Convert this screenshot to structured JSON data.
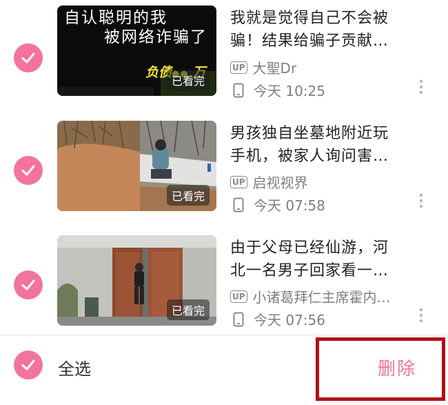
{
  "colors": {
    "accent": "#f3739f",
    "highlight_border": "#b10f17"
  },
  "videos": [
    {
      "title_line1": "我就是觉得自己不会被",
      "title_line2": "骗！结果给骗子贡献…",
      "uploader_badge": "UP",
      "uploader": "大聖Dr",
      "time": "今天 10:25",
      "watched_badge": "已看完",
      "thumb_text_line1": "自认聪明的我",
      "thumb_text_line2": "被网络诈骗了",
      "thumb_text_line3": "负债",
      "thumb_text_line3_suffix": "万",
      "checked": true
    },
    {
      "title_line1": "男孩独自坐墓地附近玩",
      "title_line2": "手机，被家人询问害…",
      "uploader_badge": "UP",
      "uploader": "启视视界",
      "time": "今天 07:58",
      "watched_badge": "已看完",
      "checked": true
    },
    {
      "title_line1": "由于父母已经仙游，河",
      "title_line2": "北一名男子回家看一…",
      "uploader_badge": "UP",
      "uploader": "小诸葛拜仁主席霍内…",
      "time": "今天 07:56",
      "watched_badge": "已看完",
      "checked": true
    }
  ],
  "bottom_bar": {
    "select_all_label": "全选",
    "delete_label": "删除"
  },
  "icons": {
    "check": "check-icon",
    "up_badge": "up-badge-icon",
    "device": "phone-icon",
    "more": "more-vertical-icon"
  }
}
